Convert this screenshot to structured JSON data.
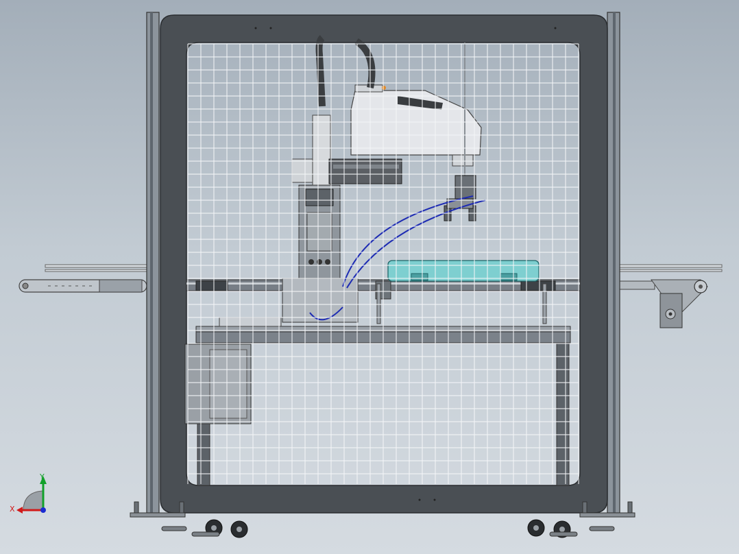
{
  "viewport": {
    "background_top": "#a3aeb9",
    "background_bottom": "#d5dbe1"
  },
  "colors": {
    "frame_dark": "#4a4f54",
    "frame_edge": "#2a2d30",
    "mesh": "#f4f6f8",
    "robot_body": "#e4e6ea",
    "robot_arm": "#5b5f64",
    "tray": "#7ecfd0",
    "air_hose": "#1d2bb3",
    "cable": "#3a3d40",
    "axis_x": "#d11a1a",
    "axis_y": "#12a12a",
    "axis_z": "#1a2bd1"
  },
  "icons": {
    "view_triad": "coordinate-triad-icon"
  },
  "triad": {
    "x_label": "X",
    "y_label": "Y"
  }
}
